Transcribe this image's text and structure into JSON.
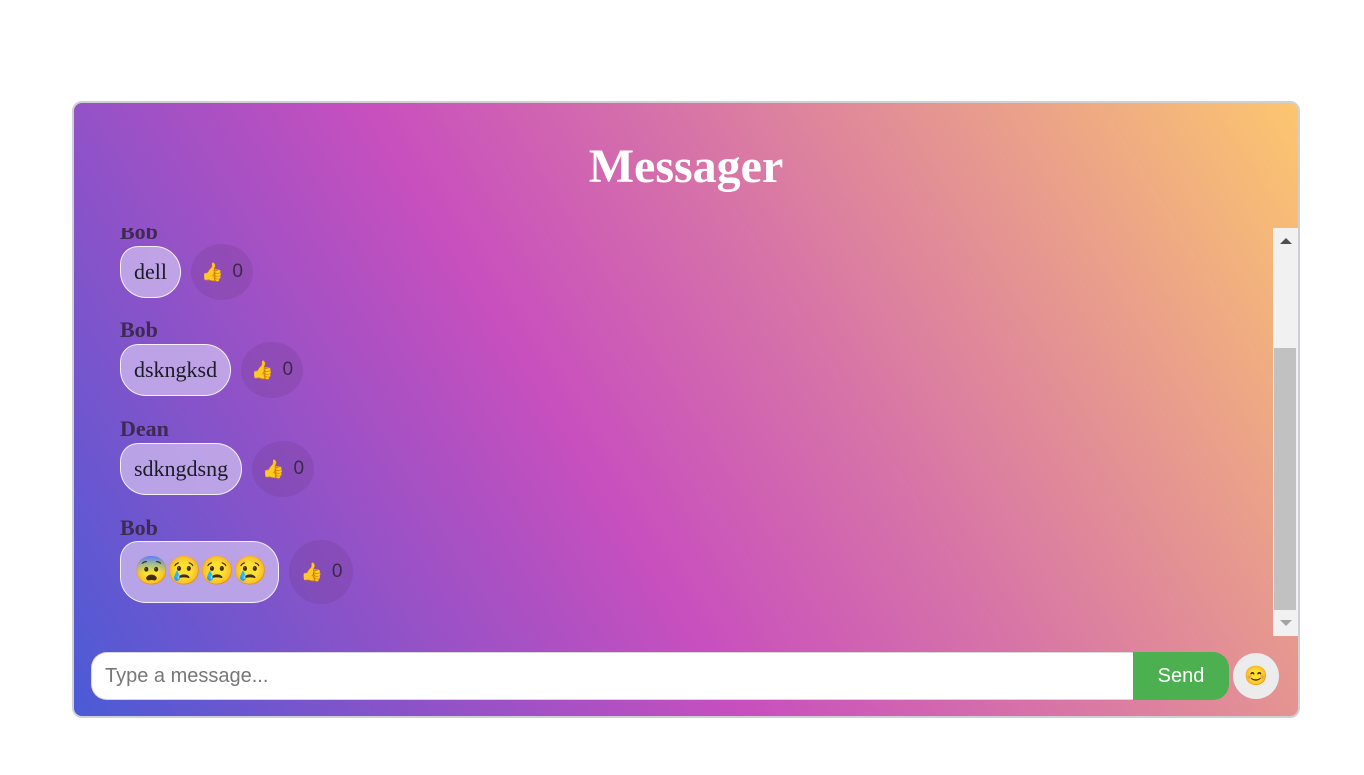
{
  "app": {
    "title": "Messager"
  },
  "messages": [
    {
      "sender": "Bob",
      "text": "dell",
      "likes": "0"
    },
    {
      "sender": "Bob",
      "text": "dskngksd",
      "likes": "0"
    },
    {
      "sender": "Dean",
      "text": "sdkngdsng",
      "likes": "0"
    },
    {
      "sender": "Bob",
      "text": "😨😢😢😢",
      "likes": "0"
    }
  ],
  "icons": {
    "like": "👍",
    "emoji_picker": "😊"
  },
  "composer": {
    "placeholder": "Type a message...",
    "value": "",
    "send_label": "Send"
  },
  "colors": {
    "send_button": "#4caf50",
    "gradient_start": "#4a5bd6",
    "gradient_mid": "#c84fbe",
    "gradient_end": "#fcc66f"
  }
}
